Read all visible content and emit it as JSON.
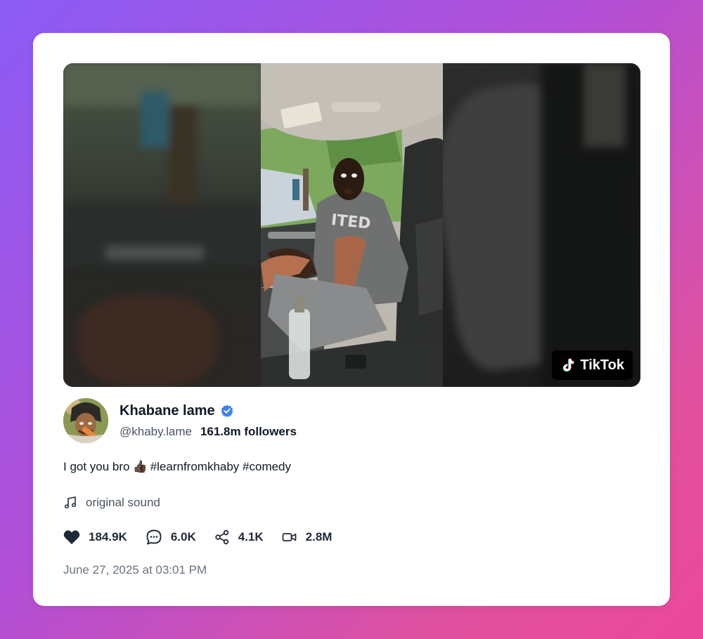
{
  "media": {
    "badge_label": "TikTok"
  },
  "author": {
    "name": "Khabane lame",
    "handle": "@khaby.lame",
    "followers": "161.8m followers",
    "verified": true
  },
  "caption": {
    "text_before": "I got you bro",
    "emoji": "👍🏿",
    "hashtags": "#learnfromkhaby #comedy"
  },
  "sound": {
    "label": "original sound"
  },
  "stats": {
    "likes": "184.9K",
    "comments": "6.0K",
    "shares": "4.1K",
    "views": "2.8M"
  },
  "timestamp": "June 27, 2025 at 03:01 PM",
  "colors": {
    "verified_blue": "#3b82f6",
    "text_primary": "#111827",
    "text_muted": "#6b7280"
  }
}
